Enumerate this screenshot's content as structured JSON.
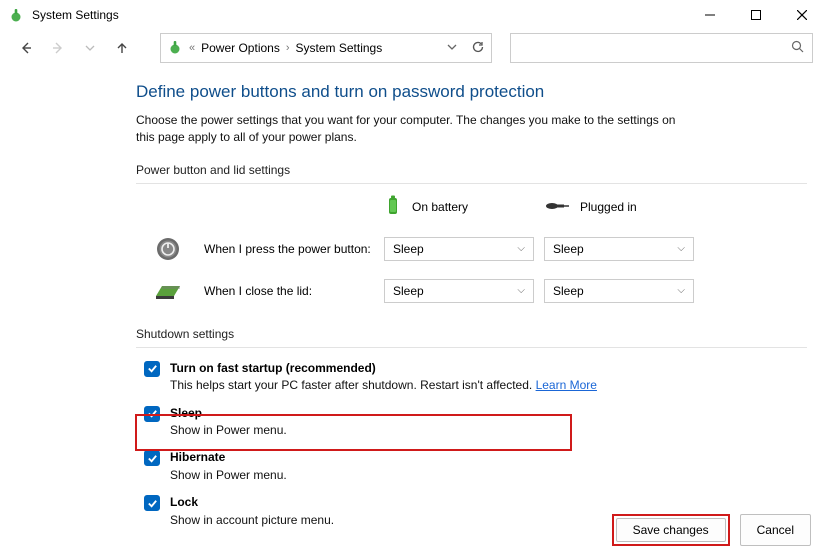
{
  "window": {
    "title": "System Settings"
  },
  "breadcrumb": {
    "c1": "Power Options",
    "c2": "System Settings"
  },
  "page": {
    "title": "Define power buttons and turn on password protection",
    "desc": "Choose the power settings that you want for your computer. The changes you make to the settings on this page apply to all of your power plans."
  },
  "powerSection": {
    "label": "Power button and lid settings",
    "col_battery": "On battery",
    "col_plugged": "Plugged in",
    "row_power_btn": "When I press the power button:",
    "row_lid": "When I close the lid:",
    "val_power_battery": "Sleep",
    "val_power_plugged": "Sleep",
    "val_lid_battery": "Sleep",
    "val_lid_plugged": "Sleep"
  },
  "shutdown": {
    "label": "Shutdown settings",
    "fast_startup_title": "Turn on fast startup (recommended)",
    "fast_startup_desc": "This helps start your PC faster after shutdown. Restart isn't affected. ",
    "learn_more": "Learn More",
    "sleep_title": "Sleep",
    "sleep_desc": "Show in Power menu.",
    "hibernate_title": "Hibernate",
    "hibernate_desc": "Show in Power menu.",
    "lock_title": "Lock",
    "lock_desc": "Show in account picture menu."
  },
  "footer": {
    "save": "Save changes",
    "cancel": "Cancel"
  }
}
